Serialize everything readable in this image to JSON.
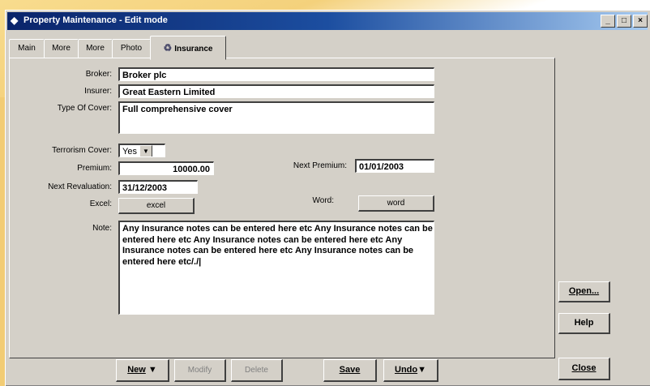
{
  "window": {
    "title": "Property Maintenance - Edit mode",
    "minimize_glyph": "_",
    "maximize_glyph": "□",
    "close_glyph": "×"
  },
  "tabs": [
    {
      "label": "Main"
    },
    {
      "label": "More"
    },
    {
      "label": "More"
    },
    {
      "label": "Photo"
    },
    {
      "label": "Insurance",
      "icon": "insurance-icon"
    }
  ],
  "form": {
    "broker_label": "Broker:",
    "broker_value": "Broker plc",
    "insurer_label": "Insurer:",
    "insurer_value": "Great Eastern Limited",
    "cover_label": "Type Of Cover:",
    "cover_value": "Full comprehensive cover",
    "terrorism_label": "Terrorism Cover:",
    "terrorism_value": "Yes",
    "premium_label": "Premium:",
    "premium_value": "10000.00",
    "next_premium_label": "Next Premium:",
    "next_premium_value": "01/01/2003",
    "next_reval_label": "Next Revaluation:",
    "next_reval_value": "31/12/2003",
    "excel_label": "Excel:",
    "excel_button": "excel",
    "word_label": "Word:",
    "word_button": "word",
    "note_label": "Note:",
    "note_value": "Any Insurance notes can be entered here etc Any Insurance notes can be entered here etc Any Insurance notes can be entered here etc Any Insurance notes can be entered here etc Any Insurance notes can be entered here etc/./|"
  },
  "side_buttons": {
    "open": "Open...",
    "help": "Help",
    "close": "Close"
  },
  "bottom_buttons": {
    "new": "New",
    "modify": "Modify",
    "delete": "Delete",
    "save": "Save",
    "undo": "Undo"
  }
}
